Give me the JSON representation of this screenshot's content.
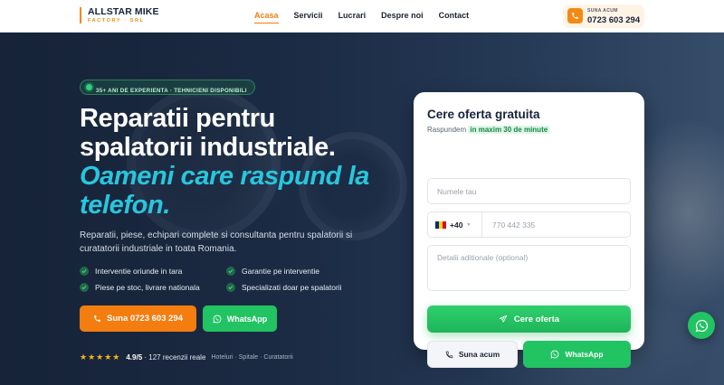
{
  "brand": {
    "name": "ALLSTAR MIKE",
    "tagline": "FACTORY · SRL",
    "accent": "#f07f0c"
  },
  "nav": {
    "items": [
      "Acasa",
      "Servicii",
      "Lucrari",
      "Despre noi",
      "Contact"
    ],
    "active": "Acasa"
  },
  "header_call": {
    "label": "SUNA ACUM",
    "number": "0723 603 294",
    "icon": "phone-icon"
  },
  "hero": {
    "badge": "35+ ANI DE EXPERIENTA · TEHNICIENI DISPONIBILI",
    "title_line1": "Reparatii pentru",
    "title_line2": "spalatorii industriale.",
    "title_accent_line1": "Oameni care raspund la",
    "title_accent_line2": "telefon.",
    "subtitle": "Reparatii, piese, echipari complete si consultanta pentru spalatorii si curatatorii industriale in toata Romania.",
    "features": [
      "Interventie oriunde in tara",
      "Garantie pe interventie",
      "Piese pe stoc, livrare nationala",
      "Specializati doar pe spalatorii"
    ],
    "call_button": "Suna 0723 603 294",
    "whatsapp_button": "WhatsApp",
    "rating": {
      "stars": "★★★★★",
      "score": "4.9/5",
      "reviews": "· 127 recenzii reale",
      "tags": "Hoteluri · Spitale · Curatatorii"
    }
  },
  "form": {
    "title": "Cere oferta gratuita",
    "subtitle_prefix": "Raspundem",
    "subtitle_highlight": "in maxim 30 de minute",
    "name_placeholder": "Numele tau",
    "country_code": "+40",
    "phone_placeholder": "770 442 335",
    "details_placeholder": "Detalii aditionale (optional)",
    "submit": "Cere oferta",
    "call_now": "Suna acum",
    "whatsapp": "WhatsApp"
  },
  "colors": {
    "orange": "#f47d10",
    "green": "#22c363",
    "cyan_accent": "#28c6dd",
    "dark_navy": "#16223b"
  }
}
